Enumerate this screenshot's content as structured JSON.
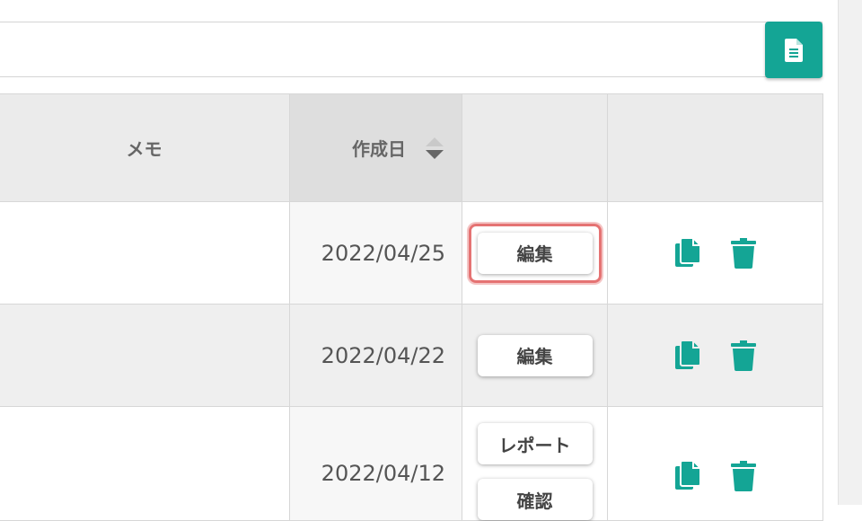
{
  "toolbar": {
    "search_value": "",
    "doc_button_icon": "document-icon"
  },
  "table": {
    "columns": {
      "memo": "メモ",
      "created": "作成日",
      "actions": "",
      "tools": ""
    },
    "sort_icon": "sort-icon",
    "rows": [
      {
        "memo": "",
        "created": "2022/04/25",
        "buttons": [
          "編集"
        ],
        "focused": true
      },
      {
        "memo": "",
        "created": "2022/04/22",
        "buttons": [
          "編集"
        ]
      },
      {
        "memo": "",
        "created": "2022/04/12",
        "buttons": [
          "レポート",
          "確認"
        ]
      }
    ],
    "row_icons": [
      "copy-icon",
      "trash-icon"
    ]
  },
  "colors": {
    "accent": "#14a595",
    "focus": "#e57373"
  }
}
